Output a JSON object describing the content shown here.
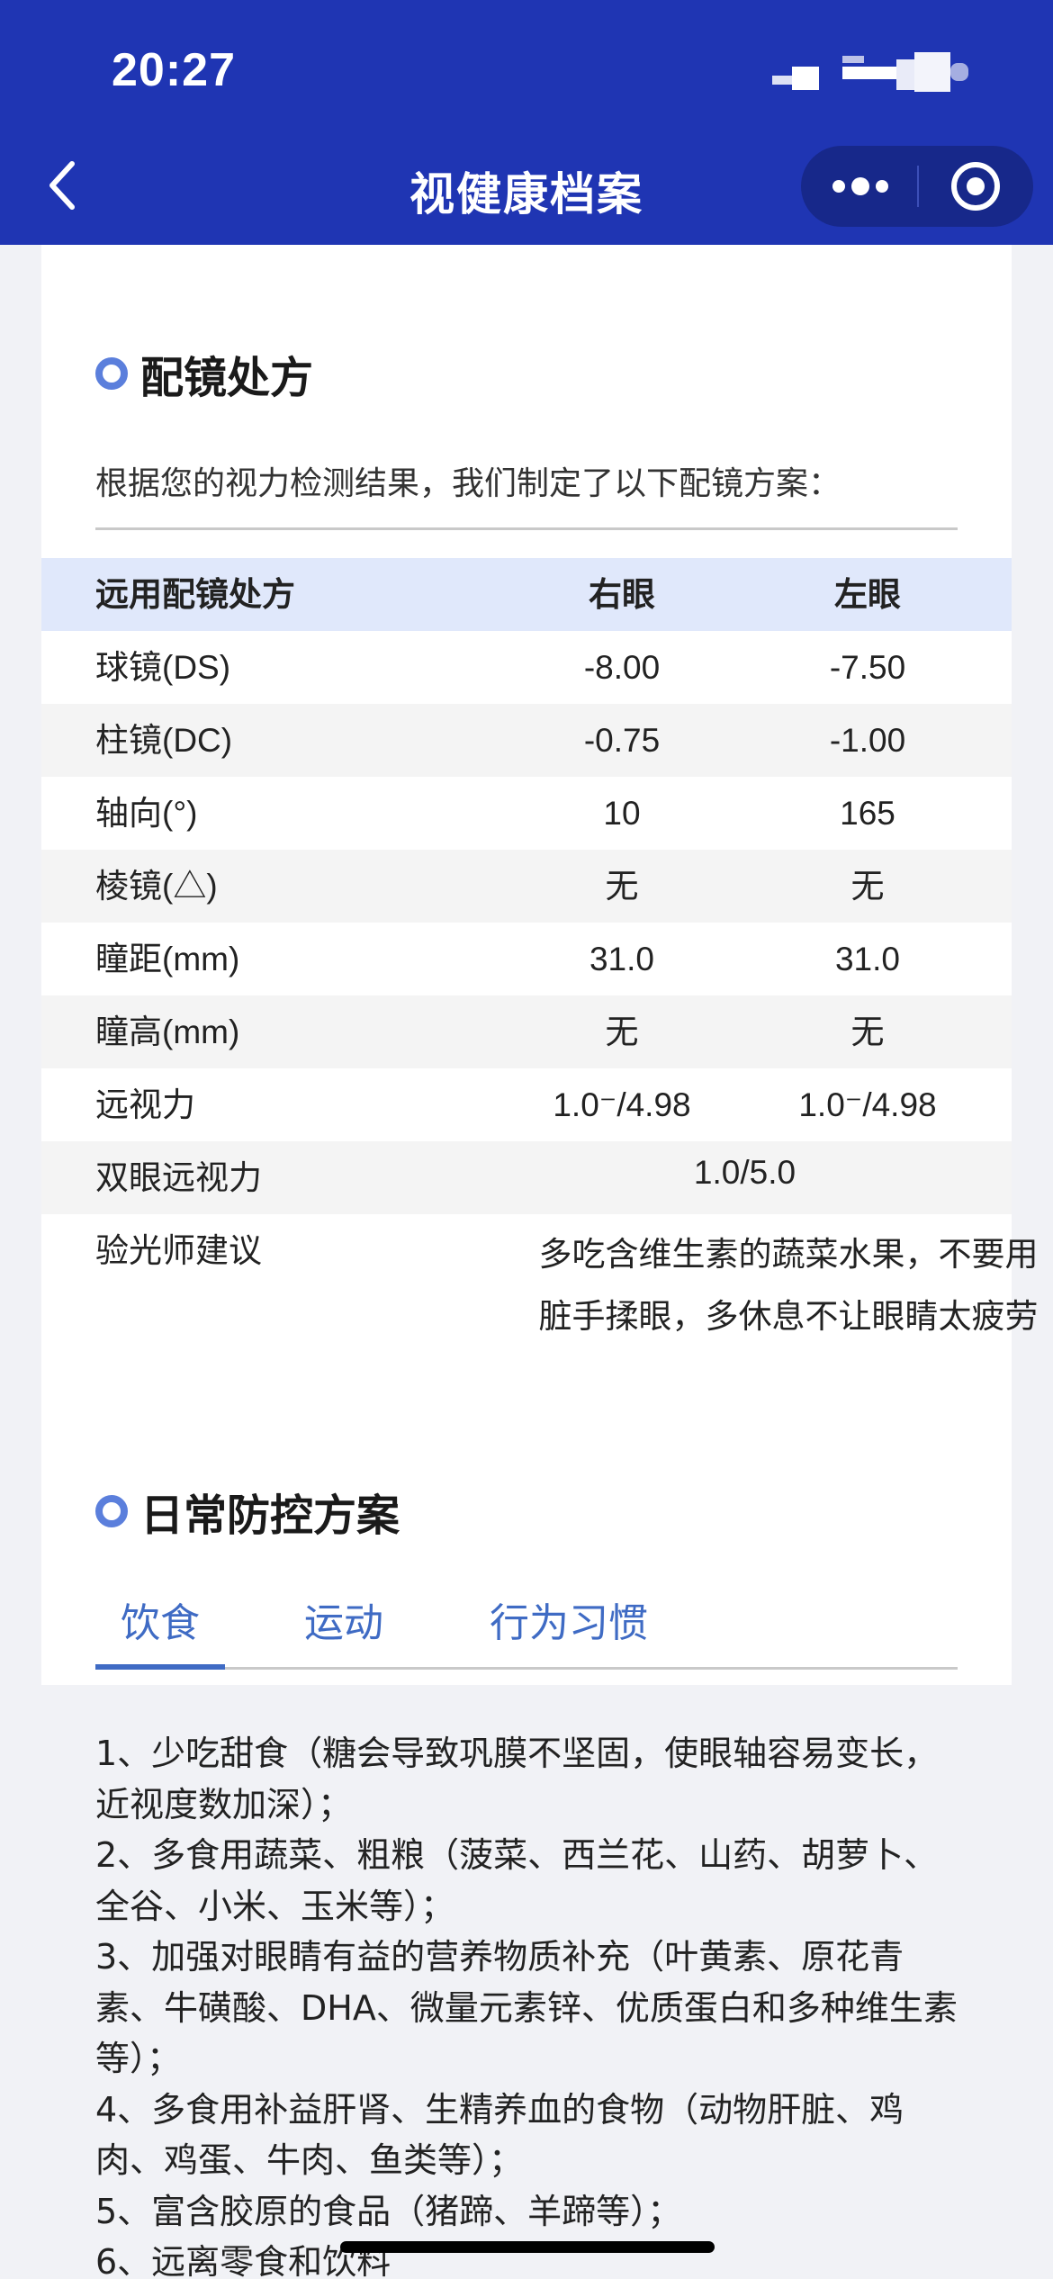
{
  "status_bar": {
    "time": "20:27"
  },
  "nav": {
    "title": "视健康档案"
  },
  "prescription": {
    "section_title": "配镜处方",
    "intro": "根据您的视力检测结果，我们制定了以下配镜方案：",
    "headers": [
      "远用配镜处方",
      "右眼",
      "左眼"
    ],
    "rows": [
      {
        "label": "球镜(DS)",
        "right": "-8.00",
        "left": "-7.50"
      },
      {
        "label": "柱镜(DC)",
        "right": "-0.75",
        "left": "-1.00"
      },
      {
        "label": "轴向(°)",
        "right": "10",
        "left": "165"
      },
      {
        "label": "棱镜(△)",
        "right": "无",
        "left": "无"
      },
      {
        "label": "瞳距(mm)",
        "right": "31.0",
        "left": "31.0"
      },
      {
        "label": "瞳高(mm)",
        "right": "无",
        "left": "无"
      },
      {
        "label": "远视力",
        "right": "1.0⁻/4.98",
        "left": "1.0⁻/4.98"
      }
    ],
    "binocular": {
      "label": "双眼远视力",
      "value": "1.0/5.0"
    },
    "advice": {
      "label": "验光师建议",
      "value": "多吃含维生素的蔬菜水果，不要用脏手揉眼，多休息不让眼睛太疲劳"
    }
  },
  "plan": {
    "section_title": "日常防控方案",
    "tabs": [
      "饮食",
      "运动",
      "行为习惯"
    ],
    "active_tab": "饮食",
    "items": [
      "1、少吃甜食（糖会导致巩膜不坚固，使眼轴容易变长，近视度数加深）；",
      "2、多食用蔬菜、粗粮（菠菜、西兰花、山药、胡萝卜、全谷、小米、玉米等）；",
      "3、加强对眼睛有益的营养物质补充（叶黄素、原花青素、牛磺酸、DHA、微量元素锌、优质蛋白和多种维生素等）；",
      "4、多食用补益肝肾、生精养血的食物（动物肝脏、鸡肉、鸡蛋、牛肉、鱼类等）；",
      "5、富含胶原的食品（猪蹄、羊蹄等）；",
      "6、远离零食和饮料"
    ]
  },
  "colors": {
    "nav_bg": "#1f35b3",
    "accent": "#3f6bc4",
    "header_row": "#e0e8fb"
  }
}
